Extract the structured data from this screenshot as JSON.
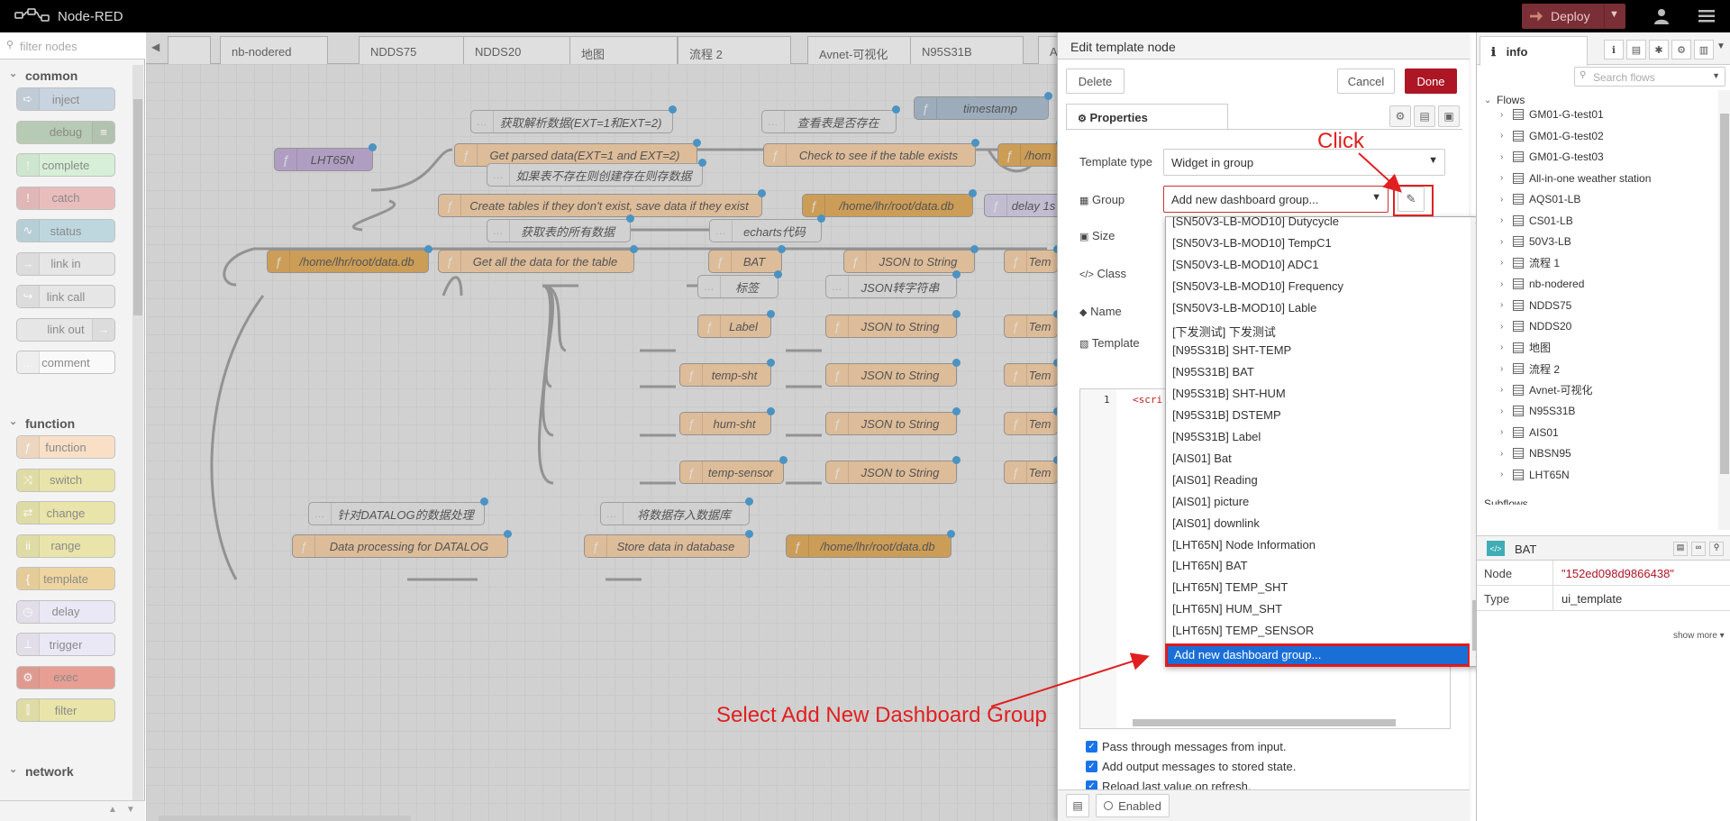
{
  "header": {
    "app_name": "Node-RED",
    "deploy_label": "Deploy"
  },
  "palette": {
    "filter_placeholder": "filter nodes",
    "categories": [
      {
        "name": "common",
        "nodes": [
          {
            "label": "inject",
            "color": "#a6bbcf"
          },
          {
            "label": "debug",
            "color": "#87a980"
          },
          {
            "label": "complete",
            "color": "#c0edc0"
          },
          {
            "label": "catch",
            "color": "#e49191"
          },
          {
            "label": "status",
            "color": "#94c1d0"
          },
          {
            "label": "link in",
            "color": "#dddddd"
          },
          {
            "label": "link call",
            "color": "#dddddd"
          },
          {
            "label": "link out",
            "color": "#dddddd"
          },
          {
            "label": "comment",
            "color": "#ffffff"
          }
        ]
      },
      {
        "name": "function",
        "nodes": [
          {
            "label": "function",
            "color": "#fdd0a2"
          },
          {
            "label": "switch",
            "color": "#e2d96e"
          },
          {
            "label": "change",
            "color": "#e2d96e"
          },
          {
            "label": "range",
            "color": "#e2d96e"
          },
          {
            "label": "template",
            "color": "#ebbd5b"
          },
          {
            "label": "delay",
            "color": "#e6e0f8"
          },
          {
            "label": "trigger",
            "color": "#e6e0f8"
          },
          {
            "label": "exec",
            "color": "#e05a44"
          },
          {
            "label": "filter",
            "color": "#e2d96e"
          }
        ]
      },
      {
        "name": "network",
        "nodes": []
      }
    ]
  },
  "workspace": {
    "tabs": [
      "",
      "nb-nodered",
      "NDDS75",
      "NDDS20",
      "地图",
      "流程 2",
      "Avnet-可视化",
      "N95S31B",
      "A"
    ],
    "nodes": {
      "n1": "获取解析数据(EXT=1和EXT=2)",
      "n2": "查看表是否存在",
      "n3": "timestamp",
      "n4": "LHT65N",
      "n5": "Get parsed data(EXT=1 and EXT=2)",
      "n6": "Check to see if the table exists",
      "n7": "/hom",
      "n8": "如果表不存在则创建存在则存数据",
      "n9": "Create tables if they don't exist, save data if they exist",
      "n10": "/home/lhr/root/data.db",
      "n11": "delay 1s",
      "n12": "获取表的所有数据",
      "n13": "echarts代码",
      "n14": "/home/lhr/root/data.db",
      "n15": "Get all the data for the table",
      "n16": "BAT",
      "n17": "JSON to String",
      "n18": "Tem",
      "n19": "标签",
      "n20": "JSON转字符串",
      "n21": "Label",
      "n22": "JSON to String",
      "n23": "Tem",
      "n24": "temp-sht",
      "n25": "JSON to String",
      "n26": "Tem",
      "n27": "hum-sht",
      "n28": "JSON to String",
      "n29": "Tem",
      "n30": "temp-sensor",
      "n31": "JSON to String",
      "n32": "Tem",
      "n33": "针对DATALOG的数据处理",
      "n34": "将数据存入数据库",
      "n35": "Data processing for DATALOG",
      "n36": "Store data in database",
      "n37": "/home/lhr/root/data.db"
    }
  },
  "editor": {
    "title": "Edit template node",
    "delete_label": "Delete",
    "cancel_label": "Cancel",
    "done_label": "Done",
    "properties_tab": "Properties",
    "template_type_label": "Template type",
    "template_type_value": "Widget in group",
    "group_label": "Group",
    "group_value": "Add new dashboard group...",
    "size_label": "Size",
    "class_label": "Class",
    "name_label": "Name",
    "template_label": "Template",
    "code_line_no": "1",
    "code_text": "<scri",
    "checkboxes": [
      {
        "label": "Pass through messages from input.",
        "checked": true
      },
      {
        "label": "Add output messages to stored state.",
        "checked": true
      },
      {
        "label": "Reload last value on refresh.",
        "checked": true
      }
    ],
    "enabled_label": "Enabled"
  },
  "group_dropdown": {
    "options": [
      "[SN50V3-LB-MOD10] Dutycycle",
      "[SN50V3-LB-MOD10] TempC1",
      "[SN50V3-LB-MOD10] ADC1",
      "[SN50V3-LB-MOD10] Frequency",
      "[SN50V3-LB-MOD10] Lable",
      "[下发测试] 下发测试",
      "[N95S31B] SHT-TEMP",
      "[N95S31B] BAT",
      "[N95S31B] SHT-HUM",
      "[N95S31B] DSTEMP",
      "[N95S31B] Label",
      "[AIS01] Bat",
      "[AIS01] Reading",
      "[AIS01] picture",
      "[AIS01] downlink",
      "[LHT65N] Node Information",
      "[LHT65N] BAT",
      "[LHT65N] TEMP_SHT",
      "[LHT65N] HUM_SHT",
      "[LHT65N] TEMP_SENSOR"
    ],
    "selected": "Add new dashboard group..."
  },
  "sidebar": {
    "tab_label": "info",
    "search_placeholder": "Search flows",
    "flows_label": "Flows",
    "flows": [
      "GM01-G-test01",
      "GM01-G-test02",
      "GM01-G-test03",
      "All-in-one weather station",
      "AQS01-LB",
      "CS01-LB",
      "50V3-LB",
      "流程 1",
      "nb-nodered",
      "NDDS75",
      "NDDS20",
      "地图",
      "流程 2",
      "Avnet-可视化",
      "N95S31B",
      "AIS01",
      "NBSN95",
      "LHT65N"
    ],
    "subflows_label": "Subflows",
    "node_title": "BAT",
    "node_key": "Node",
    "node_value": "\"152ed098d9866438\"",
    "type_key": "Type",
    "type_value": "ui_template",
    "show_more": "show more ▾"
  },
  "annotations": {
    "click": "Click",
    "select": "Select Add New Dashboard Group"
  },
  "colors": {
    "accent": "#ad1625",
    "annotation": "#e02020",
    "selection": "#1a6fd6"
  }
}
